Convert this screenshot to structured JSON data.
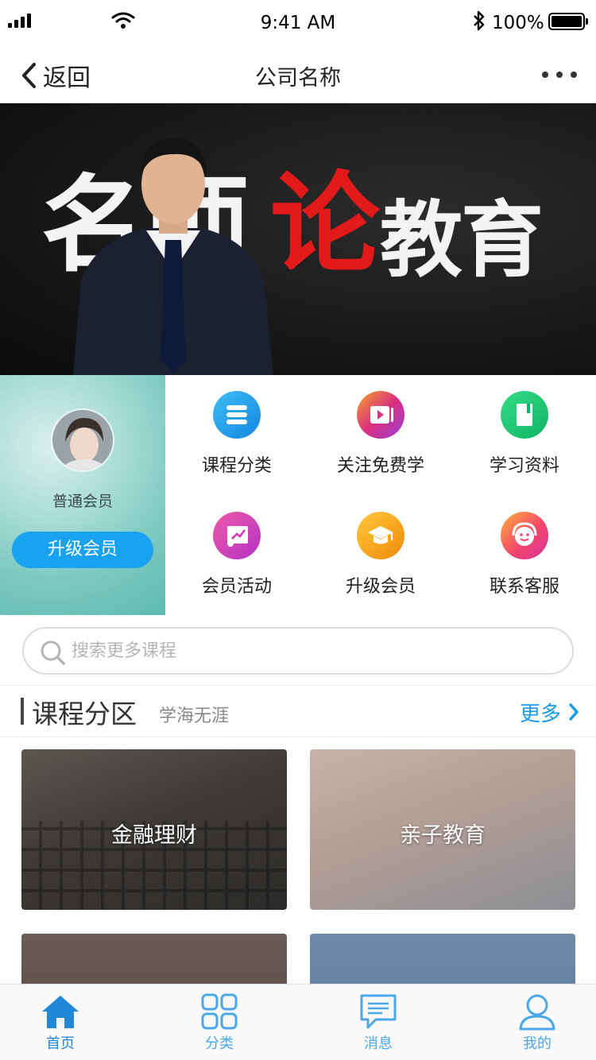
{
  "status_bar": {
    "time": "9:41 AM",
    "battery": "100%",
    "icons": [
      "signal-icon",
      "wifi-icon",
      "bluetooth-icon",
      "battery-icon"
    ]
  },
  "nav": {
    "back_label": "返回",
    "title": "公司名称",
    "icons": [
      "chevron-left-icon",
      "more-icon"
    ]
  },
  "banner": {
    "text_1": "名师",
    "text_2": "论",
    "text_3": "教育"
  },
  "profile": {
    "member_level": "普通会员",
    "upgrade_label": "升级会员"
  },
  "quick_menu": [
    {
      "label": "课程分类",
      "icon": "stack-icon",
      "color": "#1a9be8"
    },
    {
      "label": "关注免费学",
      "icon": "video-icon",
      "color": "#e0367a"
    },
    {
      "label": "学习资料",
      "icon": "book-icon",
      "color": "#16c46a"
    },
    {
      "label": "会员活动",
      "icon": "chart-board-icon",
      "color": "#d536b5"
    },
    {
      "label": "升级会员",
      "icon": "graduation-cap-icon",
      "color": "#f3a20a"
    },
    {
      "label": "联系客服",
      "icon": "headset-icon",
      "color": "#f3476a"
    }
  ],
  "search": {
    "placeholder": "搜索更多课程"
  },
  "section": {
    "title": "课程分区",
    "subtitle": "学海无涯",
    "more_label": "更多"
  },
  "courses": [
    {
      "label": "金融理财"
    },
    {
      "label": "亲子教育"
    },
    {
      "label": ""
    },
    {
      "label": ""
    }
  ],
  "tabs": [
    {
      "label": "首页",
      "icon": "home-icon",
      "active": true
    },
    {
      "label": "分类",
      "icon": "grid-icon",
      "active": false
    },
    {
      "label": "消息",
      "icon": "message-icon",
      "active": false
    },
    {
      "label": "我的",
      "icon": "user-icon",
      "active": false
    }
  ],
  "colors": {
    "accent": "#1a9be8",
    "upgrade_button": "#19a2f0",
    "banner_highlight": "#e31a1a"
  }
}
